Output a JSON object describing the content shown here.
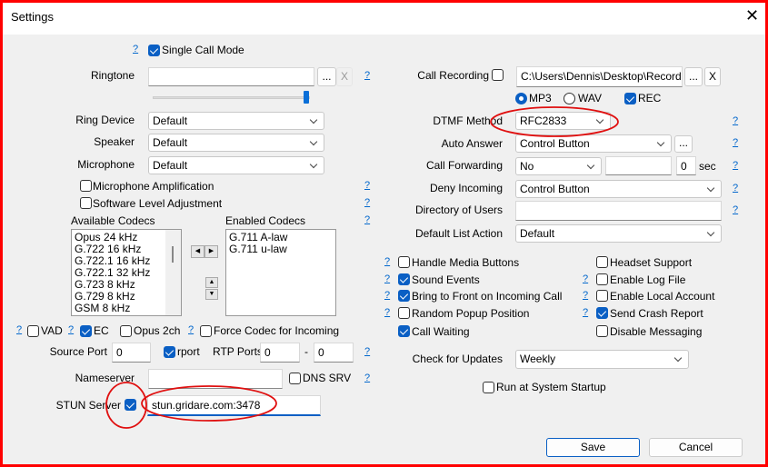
{
  "window": {
    "title": "Settings",
    "close_icon": "close-icon"
  },
  "left": {
    "single_call_mode": {
      "label": "Single Call Mode",
      "checked": true
    },
    "ringtone": {
      "label": "Ringtone",
      "value": "",
      "browse": "...",
      "clear": "X",
      "volume_percent": 97
    },
    "ring_device": {
      "label": "Ring Device",
      "value": "Default"
    },
    "speaker": {
      "label": "Speaker",
      "value": "Default"
    },
    "microphone": {
      "label": "Microphone",
      "value": "Default"
    },
    "mic_amplification": {
      "label": "Microphone Amplification",
      "checked": false
    },
    "software_level": {
      "label": "Software Level Adjustment",
      "checked": false
    },
    "available_codecs": {
      "label": "Available Codecs",
      "items": [
        "Opus 24 kHz",
        "G.722 16 kHz",
        "G.722.1 16 kHz",
        "G.722.1 32 kHz",
        "G.723 8 kHz",
        "G.729 8 kHz",
        "GSM 8 kHz"
      ]
    },
    "enabled_codecs": {
      "label": "Enabled Codecs",
      "items": [
        "G.711 A-law",
        "G.711 u-law"
      ]
    },
    "vad": {
      "label": "VAD",
      "checked": false
    },
    "ec": {
      "label": "EC",
      "checked": true
    },
    "opus2ch": {
      "label": "Opus 2ch",
      "checked": false
    },
    "force_codec": {
      "label": "Force Codec for Incoming",
      "checked": false
    },
    "source_port": {
      "label": "Source Port",
      "value": "0"
    },
    "rport": {
      "label": "rport",
      "checked": true
    },
    "rtp_ports": {
      "label": "RTP Ports",
      "from": "0",
      "sep": "-",
      "to": "0"
    },
    "nameserver": {
      "label": "Nameserver",
      "value": ""
    },
    "dns_srv": {
      "label": "DNS SRV",
      "checked": false
    },
    "stun": {
      "label": "STUN Server",
      "checked": true,
      "value": "stun.gridare.com:3478"
    }
  },
  "right": {
    "call_recording": {
      "label": "Call Recording",
      "checked": false,
      "path": "C:\\Users\\Dennis\\Desktop\\Recordings",
      "browse": "...",
      "clear": "X"
    },
    "format": {
      "mp3": "MP3",
      "wav": "WAV",
      "selected": "MP3",
      "rec_label": "REC",
      "rec_checked": true
    },
    "dtmf": {
      "label": "DTMF Method",
      "value": "RFC2833"
    },
    "auto_answer": {
      "label": "Auto Answer",
      "value": "Control Button",
      "more": "..."
    },
    "call_forwarding": {
      "label": "Call Forwarding",
      "value": "No",
      "target": "",
      "delay": "0",
      "unit": "sec"
    },
    "deny_incoming": {
      "label": "Deny Incoming",
      "value": "Control Button"
    },
    "directory": {
      "label": "Directory of Users",
      "value": ""
    },
    "default_list_action": {
      "label": "Default List Action",
      "value": "Default"
    },
    "options_left": [
      {
        "label": "Handle Media Buttons",
        "checked": false,
        "help": true
      },
      {
        "label": "Sound Events",
        "checked": true,
        "help": true
      },
      {
        "label": "Bring to Front on Incoming Call",
        "checked": true,
        "help": true
      },
      {
        "label": "Random Popup Position",
        "checked": false,
        "help": true
      },
      {
        "label": "Call Waiting",
        "checked": true,
        "help": false
      }
    ],
    "options_right": [
      {
        "label": "Headset Support",
        "checked": false,
        "help": false
      },
      {
        "label": "Enable Log File",
        "checked": false,
        "help": true
      },
      {
        "label": "Enable Local Account",
        "checked": false,
        "help": true
      },
      {
        "label": "Send Crash Report",
        "checked": true,
        "help": true
      },
      {
        "label": "Disable Messaging",
        "checked": false,
        "help": false
      }
    ],
    "check_updates": {
      "label": "Check for Updates",
      "value": "Weekly"
    },
    "run_startup": {
      "label": "Run at System Startup",
      "checked": false
    }
  },
  "help": "?",
  "buttons": {
    "save": "Save",
    "cancel": "Cancel"
  },
  "annotation_color": "#e01010"
}
